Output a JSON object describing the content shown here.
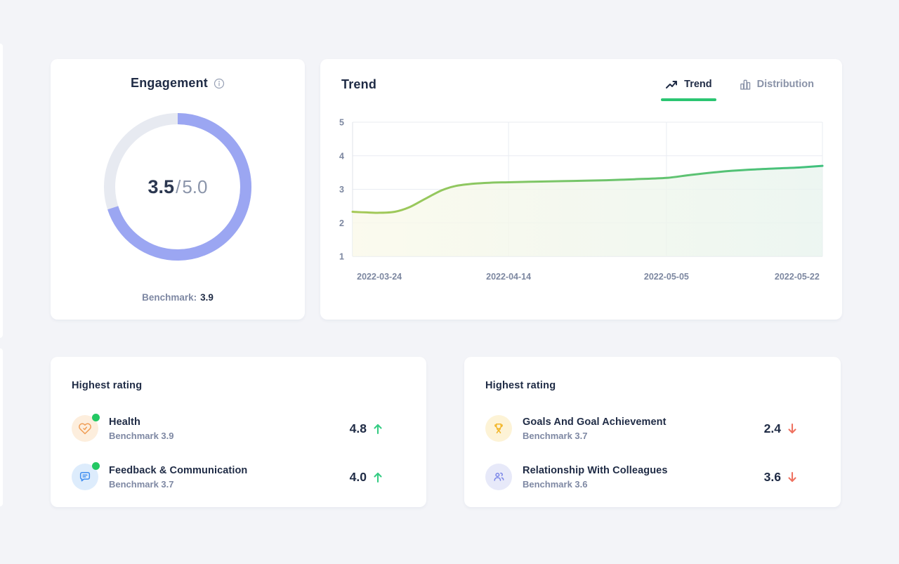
{
  "colors": {
    "navy": "#1f2b45",
    "gray": "#7e88a3",
    "green": "#2bc572",
    "red": "#ef7261",
    "ring": "#9ba6f2",
    "track": "#e7eaf1",
    "page_bg": "#f3f4f8",
    "card_bg": "#ffffff",
    "grid": "#e9ecf2",
    "axis": "#dfe3ea",
    "tick": "#7c87a0",
    "heart": "#f09d55",
    "heart_bg": "#fdeedd",
    "chat": "#3f8ef0",
    "chat_bg": "#ddecfc",
    "trophy": "#f2b62a",
    "trophy_bg": "#fdf3d6",
    "people": "#7b86e8",
    "people_bg": "#e7e9f9",
    "dot": "#23c863",
    "tab_inactive": "#8a93a8"
  },
  "engagement": {
    "title": "Engagement",
    "score": "3.5",
    "divider": "/",
    "max": "5.0",
    "score_value": 3.5,
    "max_value": 5.0,
    "benchmark_label": "Benchmark:",
    "benchmark_value": "3.9"
  },
  "trend_card": {
    "title": "Trend",
    "tabs": [
      {
        "label": "Trend",
        "icon": "trending-up-icon",
        "active": true
      },
      {
        "label": "Distribution",
        "icon": "bar-chart-icon",
        "active": false
      }
    ]
  },
  "chart_data": {
    "type": "area",
    "title": "Trend",
    "ylim": [
      1,
      5
    ],
    "y_ticks": [
      1,
      2,
      3,
      4,
      5
    ],
    "grid": true,
    "legend": "none",
    "x_tick_labels": [
      "2022-03-24",
      "2022-04-14",
      "2022-05-05",
      "2022-05-22"
    ],
    "x_tick_positions": [
      0.057,
      0.332,
      0.668,
      0.946
    ],
    "x_gridline_positions": [
      0,
      0.332,
      0.668,
      1
    ],
    "series": [
      {
        "name": "Engagement trend",
        "x_fraction": [
          0,
          0.03,
          0.057,
          0.09,
          0.12,
          0.155,
          0.19,
          0.22,
          0.26,
          0.3,
          0.332,
          0.4,
          0.47,
          0.54,
          0.6,
          0.668,
          0.72,
          0.78,
          0.84,
          0.9,
          0.95,
          1.0
        ],
        "values": [
          2.33,
          2.31,
          2.3,
          2.33,
          2.46,
          2.72,
          2.97,
          3.1,
          3.17,
          3.2,
          3.21,
          3.23,
          3.25,
          3.27,
          3.3,
          3.34,
          3.43,
          3.52,
          3.58,
          3.62,
          3.65,
          3.7
        ]
      }
    ],
    "line_gradient": [
      "#a7c957",
      "#3fc07d"
    ],
    "area_gradient": [
      "#faf9e9",
      "#e8f4ee"
    ]
  },
  "ratings_left": {
    "header": "Highest rating",
    "items": [
      {
        "title": "Health",
        "benchmark": "Benchmark 3.9",
        "value": "4.8",
        "direction": "up",
        "icon": "heart-icon",
        "status_dot": true
      },
      {
        "title": "Feedback & Communication",
        "benchmark": "Benchmark 3.7",
        "value": "4.0",
        "direction": "up",
        "icon": "chat-bubble-icon",
        "status_dot": true
      }
    ]
  },
  "ratings_right": {
    "header": "Highest rating",
    "items": [
      {
        "title": "Goals And Goal Achievement",
        "benchmark": "Benchmark 3.7",
        "value": "2.4",
        "direction": "down",
        "icon": "trophy-icon",
        "status_dot": false
      },
      {
        "title": "Relationship With Colleagues",
        "benchmark": "Benchmark 3.6",
        "value": "3.6",
        "direction": "down",
        "icon": "people-icon",
        "status_dot": false
      }
    ]
  }
}
